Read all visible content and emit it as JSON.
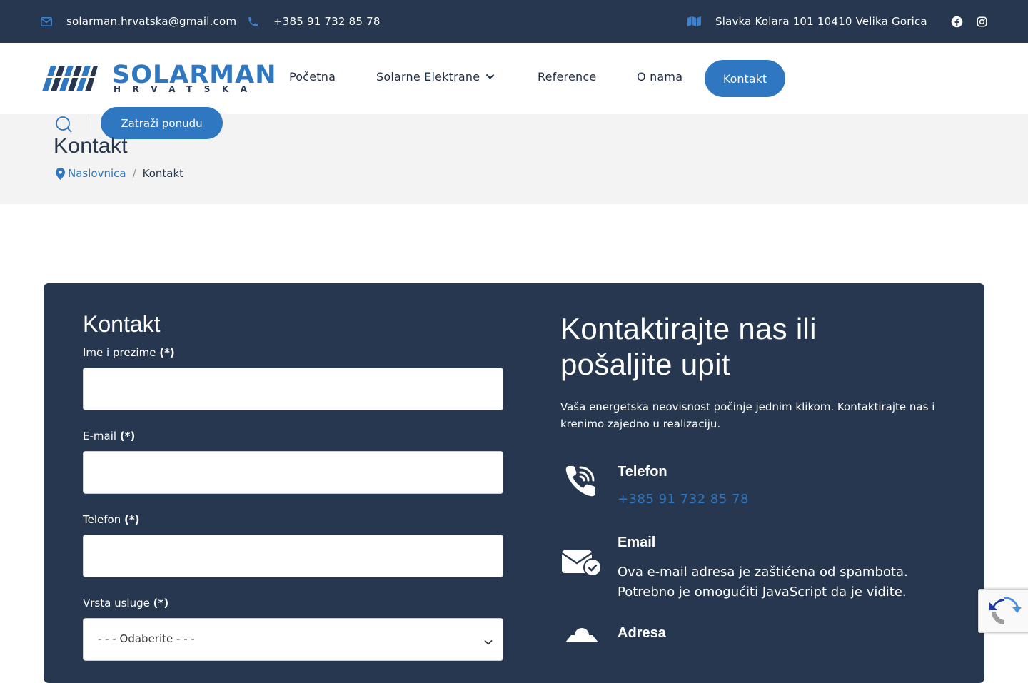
{
  "topbar": {
    "email": "solarman.hrvatska@gmail.com",
    "phone": "+385 91 732 85 78",
    "address": "Slavka Kolara 101 10410 Velika Gorica",
    "icons": [
      "envelope-icon",
      "phone-icon",
      "map-icon",
      "facebook-icon",
      "instagram-icon"
    ]
  },
  "logo": {
    "name": "SOLARMAN",
    "subtitle": "HRVATSKA"
  },
  "nav": {
    "items": [
      "Početna",
      "Solarne Elektrane",
      "Reference",
      "O nama"
    ],
    "cta": "Kontakt"
  },
  "hero": {
    "quote_button": "Zatraži ponudu",
    "title": "Kontakt",
    "breadcrumb": {
      "home": "Naslovnica",
      "separator": "/",
      "current": "Kontakt"
    }
  },
  "form": {
    "title": "Kontakt",
    "required_mark": "(*)",
    "fields": {
      "name": {
        "label": "Ime i prezime"
      },
      "email": {
        "label": "E-mail"
      },
      "phone": {
        "label": "Telefon"
      },
      "service": {
        "label": "Vrsta usluge",
        "selected": "- - - Odaberite - - -"
      }
    }
  },
  "info": {
    "title": "Kontaktirajte nas ili pošaljite upit",
    "text": "Vaša energetska neovisnost počinje jednim klikom. Kontaktirajte nas i krenimo zajedno u realizaciju.",
    "phone": {
      "heading": "Telefon",
      "value": "+385 91 732 85 78"
    },
    "email": {
      "heading": "Email",
      "value": "Ova e-mail adresa je zaštićena od spambota. Potrebno je omogućiti JavaScript da je vidite."
    },
    "address": {
      "heading": "Adresa"
    }
  },
  "colors": {
    "navy": "#27374f",
    "blue": "#2f77c0",
    "light_bg": "#f3f3f3"
  }
}
